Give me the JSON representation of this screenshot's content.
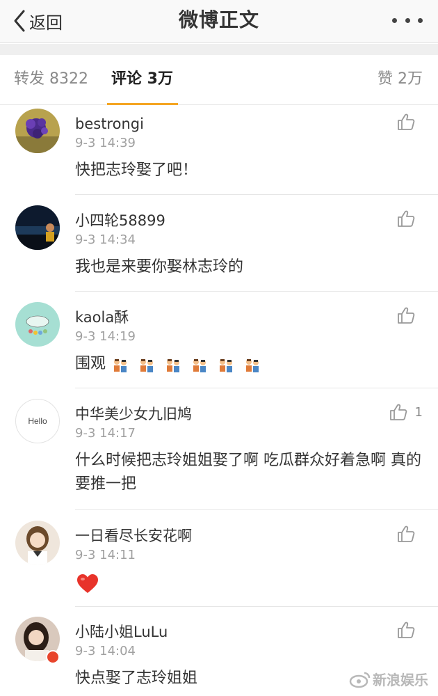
{
  "nav": {
    "back_label": "返回",
    "title": "微博正文"
  },
  "tabs": {
    "repost": "转发 8322",
    "comment": "评论 3万",
    "like": "赞 2万"
  },
  "comments": [
    {
      "username": "bestrongi",
      "time": "9-3 14:39",
      "text": "快把志玲娶了吧！",
      "likes": ""
    },
    {
      "username": "小四轮58899",
      "time": "9-3 14:34",
      "text": "我也是来要你娶林志玲的",
      "likes": ""
    },
    {
      "username": "kaola酥",
      "time": "9-3 14:19",
      "text": "围观",
      "likes": ""
    },
    {
      "username": "中华美少女九旧鸠",
      "time": "9-3 14:17",
      "text": "什么时候把志玲姐姐娶了啊 吃瓜群众好着急啊 真的要推一把",
      "likes": "1"
    },
    {
      "username": "一日看尽长安花啊",
      "time": "9-3 14:11",
      "text": "",
      "likes": ""
    },
    {
      "username": "小陆小姐LuLu",
      "time": "9-3 14:04",
      "text": "快点娶了志玲姐姐",
      "likes": ""
    }
  ],
  "hello_avatar_text": "Hello",
  "watermark": "新浪娱乐",
  "colors": {
    "accent": "#f5a623",
    "heart": "#e8332a"
  }
}
